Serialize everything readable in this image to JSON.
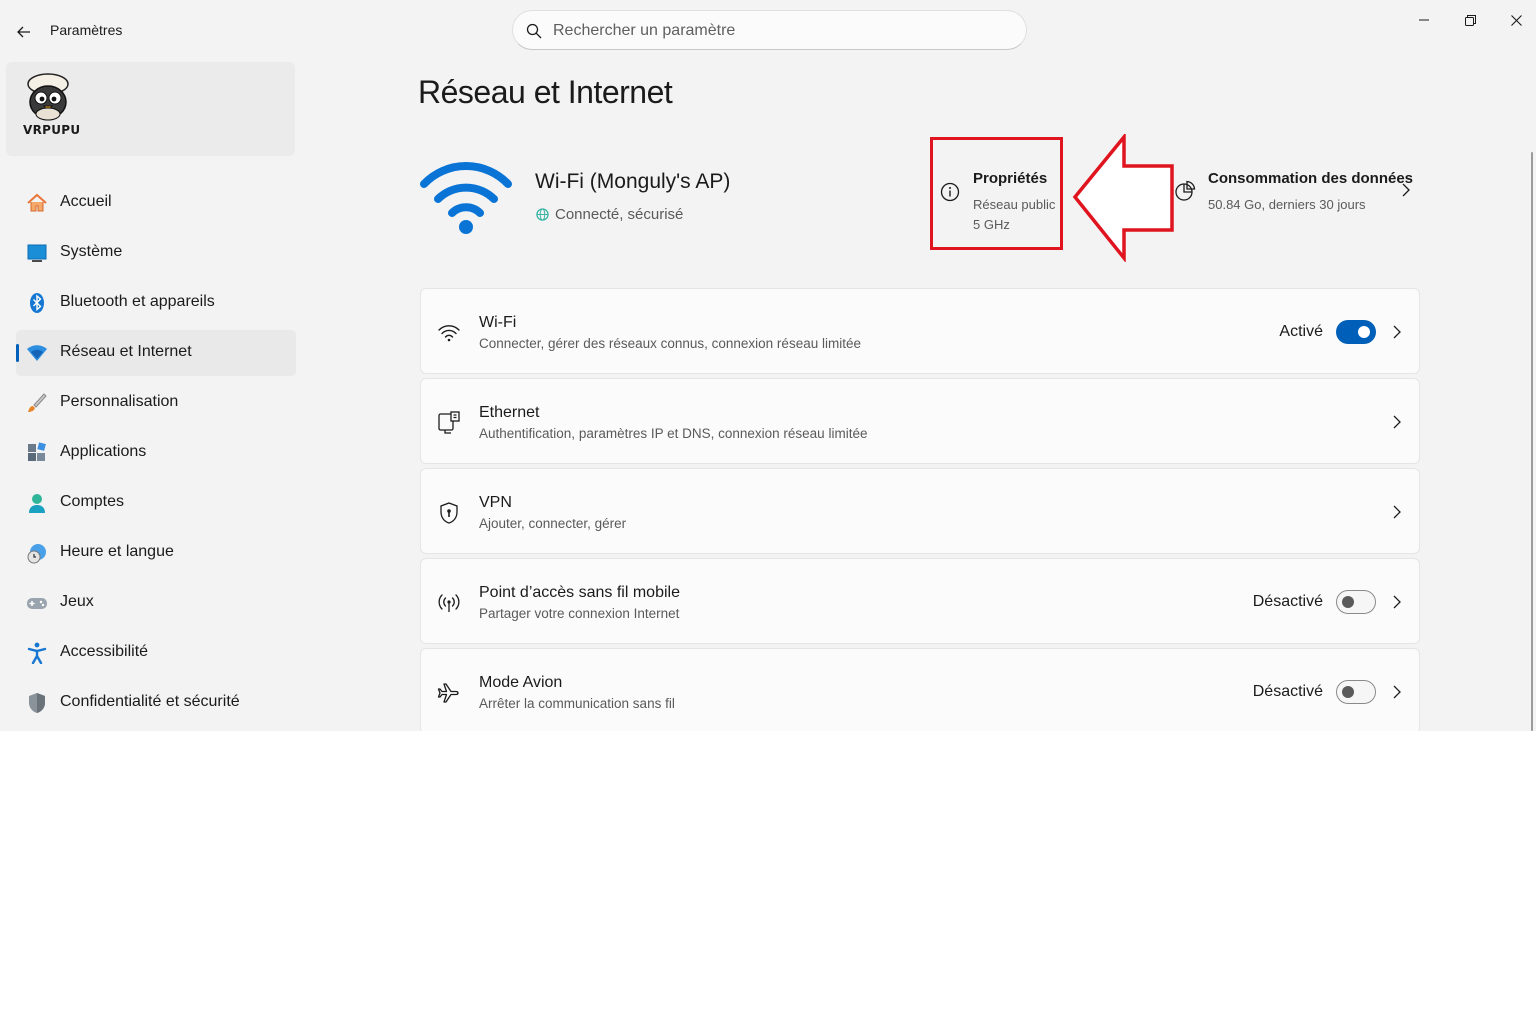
{
  "titlebar": {
    "app_title": "Paramètres",
    "search_placeholder": "Rechercher un paramètre"
  },
  "profile": {
    "name": "VRPUPU"
  },
  "sidebar": {
    "items": [
      {
        "label": "Accueil",
        "icon": "home-icon",
        "active": false
      },
      {
        "label": "Système",
        "icon": "system-icon",
        "active": false
      },
      {
        "label": "Bluetooth et appareils",
        "icon": "bluetooth-icon",
        "active": false
      },
      {
        "label": "Réseau et Internet",
        "icon": "network-icon",
        "active": true
      },
      {
        "label": "Personnalisation",
        "icon": "brush-icon",
        "active": false
      },
      {
        "label": "Applications",
        "icon": "apps-icon",
        "active": false
      },
      {
        "label": "Comptes",
        "icon": "account-icon",
        "active": false
      },
      {
        "label": "Heure et langue",
        "icon": "time-language-icon",
        "active": false
      },
      {
        "label": "Jeux",
        "icon": "gamepad-icon",
        "active": false
      },
      {
        "label": "Accessibilité",
        "icon": "accessibility-icon",
        "active": false
      },
      {
        "label": "Confidentialité et sécurité",
        "icon": "shield-icon",
        "active": false
      }
    ]
  },
  "main": {
    "page_title": "Réseau et Internet",
    "network": {
      "name": "Wi-Fi (Monguly's AP)",
      "status": "Connecté, sécurisé"
    },
    "properties": {
      "title": "Propriétés",
      "line1": "Réseau public",
      "line2": "5 GHz"
    },
    "usage": {
      "title": "Consommation des données",
      "subtitle": "50.84 Go, derniers 30 jours"
    },
    "cards": [
      {
        "title": "Wi-Fi",
        "subtitle": "Connecter, gérer des réseaux connus, connexion réseau limitée",
        "state": "Activé",
        "toggle": true,
        "icon": "wifi-icon"
      },
      {
        "title": "Ethernet",
        "subtitle": "Authentification, paramètres IP et DNS, connexion réseau limitée",
        "state": "",
        "toggle": null,
        "icon": "ethernet-icon"
      },
      {
        "title": "VPN",
        "subtitle": "Ajouter, connecter, gérer",
        "state": "",
        "toggle": null,
        "icon": "vpn-shield-icon"
      },
      {
        "title": "Point d’accès sans fil mobile",
        "subtitle": "Partager votre connexion Internet",
        "state": "Désactivé",
        "toggle": false,
        "icon": "hotspot-icon"
      },
      {
        "title": "Mode Avion",
        "subtitle": "Arrêter la communication sans fil",
        "state": "Désactivé",
        "toggle": false,
        "icon": "airplane-icon"
      }
    ]
  },
  "colors": {
    "accent": "#005fb8",
    "highlight": "#e0141e",
    "wifi_blue": "#0a74d6"
  }
}
